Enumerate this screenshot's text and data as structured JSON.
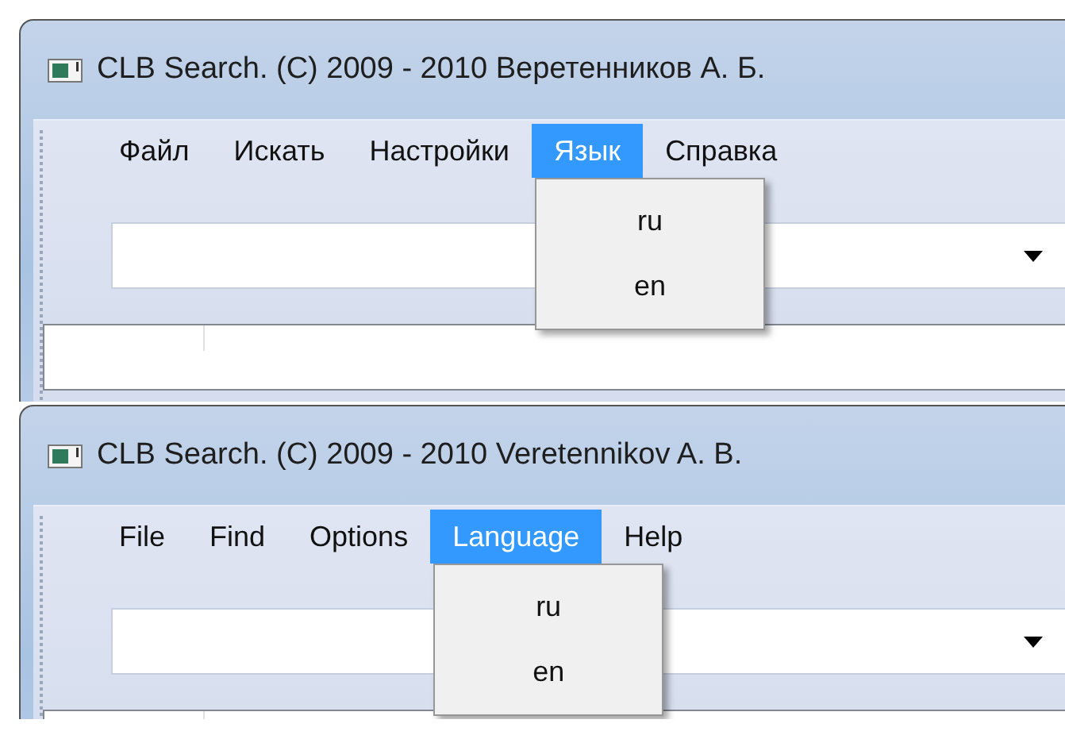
{
  "screens": [
    {
      "window": {
        "title": "CLB Search. (C) 2009 - 2010 Веретенников А. Б."
      },
      "menu": [
        {
          "label": "Файл",
          "selected": false
        },
        {
          "label": "Искать",
          "selected": false
        },
        {
          "label": "Настройки",
          "selected": false
        },
        {
          "label": "Язык",
          "selected": true
        },
        {
          "label": "Справка",
          "selected": false
        }
      ],
      "dropdown": {
        "items": [
          "ru",
          "en"
        ]
      }
    },
    {
      "window": {
        "title": "CLB Search. (C) 2009 - 2010 Veretennikov A. B."
      },
      "menu": [
        {
          "label": "File",
          "selected": false
        },
        {
          "label": "Find",
          "selected": false
        },
        {
          "label": "Options",
          "selected": false
        },
        {
          "label": "Language",
          "selected": true
        },
        {
          "label": "Help",
          "selected": false
        }
      ],
      "dropdown": {
        "items": [
          "ru",
          "en"
        ]
      }
    }
  ]
}
